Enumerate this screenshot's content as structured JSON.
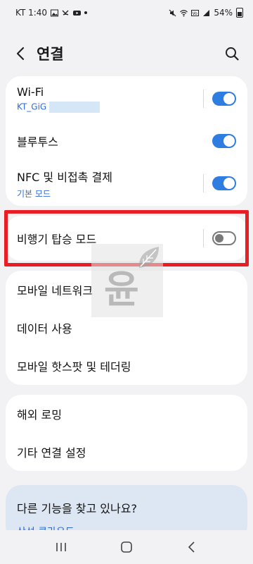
{
  "status_bar": {
    "carrier_time": "KT 1:40",
    "battery": "54%"
  },
  "header": {
    "title": "연결",
    "back_icon": "chevron-left-icon",
    "search_icon": "search-icon"
  },
  "cards": {
    "group1": [
      {
        "label": "Wi-Fi",
        "sub": "KT_GiG",
        "toggle": true
      },
      {
        "label": "블루투스",
        "toggle": true
      },
      {
        "label": "NFC 및 비접촉 결제",
        "sub": "기본 모드",
        "toggle": true
      }
    ],
    "airplane": {
      "label": "비행기 탑승 모드",
      "toggle": false
    },
    "group2": [
      {
        "label": "모바일 네트워크"
      },
      {
        "label": "데이터 사용"
      },
      {
        "label": "모바일 핫스팟 및 테더링"
      }
    ],
    "group3": [
      {
        "label": "해외 로밍"
      },
      {
        "label": "기타 연결 설정"
      }
    ]
  },
  "help": {
    "title": "다른 기능을 찾고 있나요?",
    "link": "삼성 클라우드"
  },
  "watermark": "윤",
  "colors": {
    "accent": "#2e7de1",
    "highlight": "#ea1d25",
    "background": "#f2f2f4"
  }
}
